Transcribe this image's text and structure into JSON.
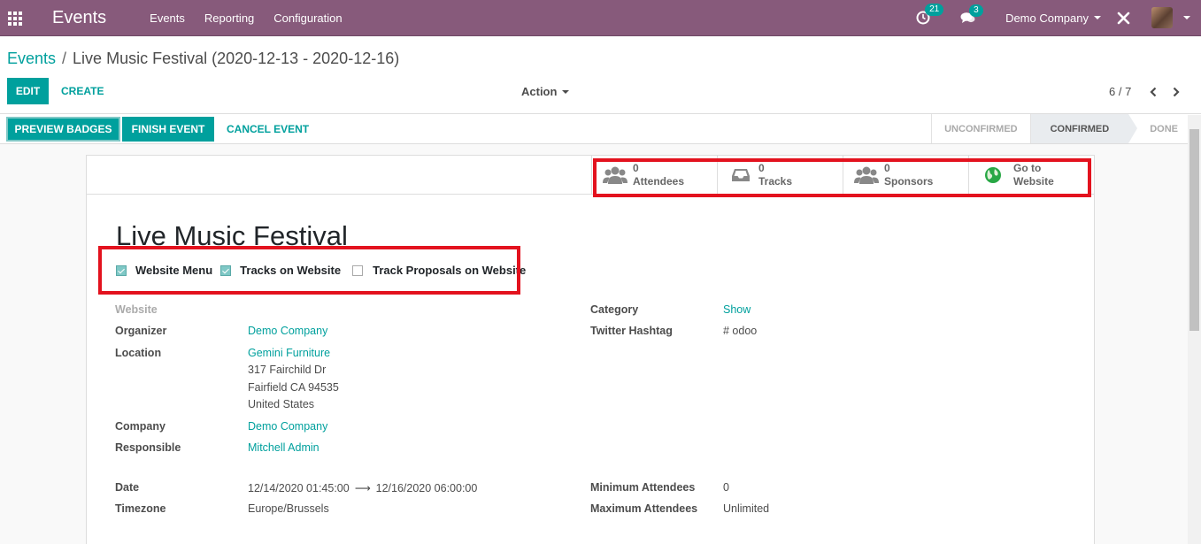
{
  "app": {
    "title": "Events",
    "menu": [
      "Events",
      "Reporting",
      "Configuration"
    ],
    "activity_count": "21",
    "message_count": "3",
    "company": "Demo Company"
  },
  "breadcrumb": {
    "parent": "Events",
    "current": "Live Music Festival (2020-12-13 - 2020-12-16)"
  },
  "control": {
    "edit_label": "EDIT",
    "create_label": "CREATE",
    "action_label": "Action",
    "pager": "6 / 7"
  },
  "header": {
    "buttons": [
      "PREVIEW BADGES",
      "FINISH EVENT",
      "CANCEL EVENT"
    ],
    "stages": [
      "UNCONFIRMED",
      "CONFIRMED",
      "DONE"
    ],
    "active_stage": "CONFIRMED"
  },
  "smart_buttons": [
    {
      "value": "0",
      "label": "Attendees",
      "icon": "users-icon"
    },
    {
      "value": "0",
      "label": "Tracks",
      "icon": "inbox-icon"
    },
    {
      "value": "0",
      "label": "Sponsors",
      "icon": "users-icon"
    },
    {
      "value": "Go to",
      "label": "Website",
      "icon": "globe-icon"
    }
  ],
  "event": {
    "name": "Live Music Festival",
    "options": [
      {
        "label": "Website Menu",
        "checked": true
      },
      {
        "label": "Tracks on Website",
        "checked": true
      },
      {
        "label": "Track Proposals on Website",
        "checked": false
      }
    ]
  },
  "fields": {
    "website_label": "Website",
    "organizer_label": "Organizer",
    "organizer": "Demo Company",
    "location_label": "Location",
    "location_name": "Gemini Furniture",
    "location_street": "317 Fairchild Dr",
    "location_city": "Fairfield CA 94535",
    "location_country": "United States",
    "company_label": "Company",
    "company": "Demo Company",
    "responsible_label": "Responsible",
    "responsible": "Mitchell Admin",
    "category_label": "Category",
    "category": "Show",
    "twitter_label": "Twitter Hashtag",
    "twitter": "# odoo",
    "date_label": "Date",
    "date_begin": "12/14/2020 01:45:00",
    "date_end": "12/16/2020 06:00:00",
    "timezone_label": "Timezone",
    "timezone": "Europe/Brussels",
    "min_attendees_label": "Minimum Attendees",
    "min_attendees": "0",
    "max_attendees_label": "Maximum Attendees",
    "max_attendees": "Unlimited"
  },
  "colors": {
    "brand": "#875a7b",
    "accent": "#00a09d",
    "highlight_box": "#e3121e"
  }
}
